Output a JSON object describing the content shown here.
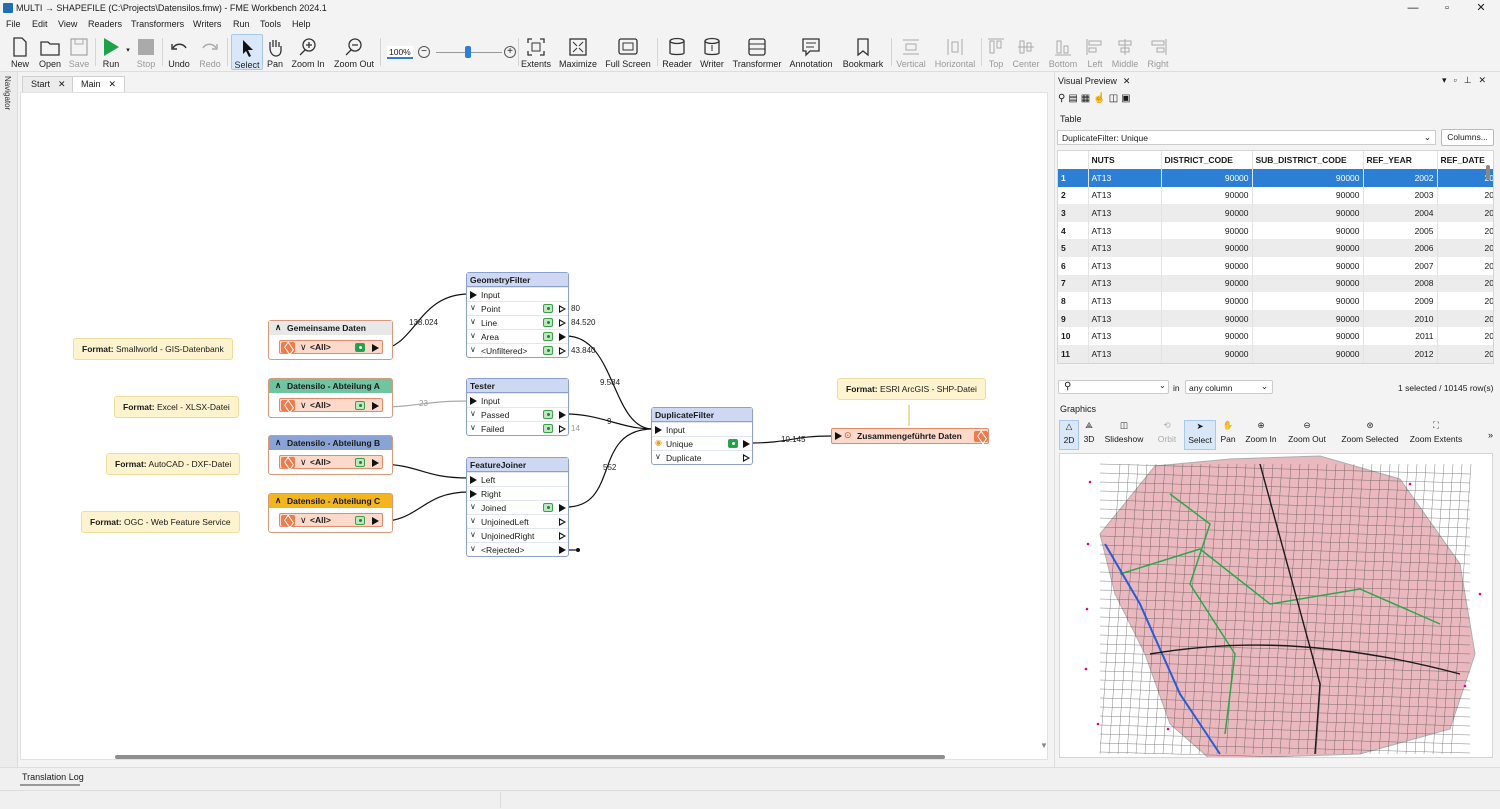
{
  "window": {
    "title": "MULTI → SHAPEFILE (C:\\Projects\\Datensilos.fmw) - FME Workbench 2024.1",
    "minimize": "—",
    "maximize": "▫",
    "close": "✕"
  },
  "menu": [
    "File",
    "Edit",
    "View",
    "Readers",
    "Transformers",
    "Writers",
    "Run",
    "Tools",
    "Help"
  ],
  "toolbar": {
    "new": "New",
    "open": "Open",
    "save": "Save",
    "run": "Run",
    "stop": "Stop",
    "undo": "Undo",
    "redo": "Redo",
    "select": "Select",
    "pan": "Pan",
    "zoom_in": "Zoom In",
    "zoom_out": "Zoom Out",
    "zoom_level": "100%",
    "extents": "Extents",
    "maximize": "Maximize",
    "full_screen": "Full Screen",
    "reader": "Reader",
    "writer": "Writer",
    "transformer": "Transformer",
    "annotation": "Annotation",
    "bookmark": "Bookmark",
    "vertical": "Vertical",
    "horizontal": "Horizontal",
    "top": "Top",
    "center": "Center",
    "bottom": "Bottom",
    "left": "Left",
    "middle": "Middle",
    "right": "Right"
  },
  "navigator_label": "Navigator",
  "tabs": [
    {
      "label": "Start",
      "close": "✕"
    },
    {
      "label": "Main",
      "close": "✕"
    }
  ],
  "annotations": {
    "a1": {
      "key": "Format:",
      "value": "Smallworld - GIS-Datenbank"
    },
    "a2": {
      "key": "Format:",
      "value": "Excel - XLSX-Datei"
    },
    "a3": {
      "key": "Format:",
      "value": "AutoCAD - DXF-Datei"
    },
    "a4": {
      "key": "Format:",
      "value": "OGC - Web Feature Service"
    },
    "a5": {
      "key": "Format:",
      "value": "ESRI ArcGIS - SHP-Datei"
    }
  },
  "readers": [
    {
      "title": "Gemeinsame Daten",
      "port": "<All>",
      "color": "#e8e8e8"
    },
    {
      "title": "Datensilo - Abteilung A",
      "port": "<All>",
      "color": "#6fc4a2"
    },
    {
      "title": "Datensilo - Abteilung B",
      "port": "<All>",
      "color": "#8aa3d6"
    },
    {
      "title": "Datensilo - Abteilung C",
      "port": "<All>",
      "color": "#f2b41f"
    }
  ],
  "geometryfilter": {
    "title": "GeometryFilter",
    "input": "Input",
    "ports": [
      "Point",
      "Line",
      "Area",
      "<Unfiltered>"
    ],
    "counts": [
      "80",
      "84.520",
      "",
      "43.840"
    ]
  },
  "tester": {
    "title": "Tester",
    "input": "Input",
    "ports": [
      "Passed",
      "Failed"
    ],
    "counts": [
      "",
      "14"
    ]
  },
  "featurejoiner": {
    "title": "FeatureJoiner",
    "inputs": [
      "Left",
      "Right"
    ],
    "ports": [
      "Joined",
      "UnjoinedLeft",
      "UnjoinedRight",
      "<Rejected>"
    ]
  },
  "duplicatefilter": {
    "title": "DuplicateFilter",
    "input": "Input",
    "ports": [
      "Unique",
      "Duplicate"
    ]
  },
  "writer": {
    "title": "Zusammengeführte Daten"
  },
  "links": {
    "l1": "138.024",
    "l2": "23",
    "l3": "9.584",
    "l4": "9",
    "l5": "552",
    "l6": "10.145"
  },
  "preview": {
    "panel_title": "Visual Preview",
    "close": "✕",
    "table_label": "Table",
    "source_select": "DuplicateFilter: Unique",
    "columns_button": "Columns...",
    "headers": [
      "",
      "NUTS",
      "DISTRICT_CODE",
      "SUB_DISTRICT_CODE",
      "REF_YEAR",
      "REF_DATE"
    ],
    "rows": [
      [
        "1",
        "AT13",
        "90000",
        "90000",
        "2002",
        "20"
      ],
      [
        "2",
        "AT13",
        "90000",
        "90000",
        "2003",
        "20"
      ],
      [
        "3",
        "AT13",
        "90000",
        "90000",
        "2004",
        "20"
      ],
      [
        "4",
        "AT13",
        "90000",
        "90000",
        "2005",
        "20"
      ],
      [
        "5",
        "AT13",
        "90000",
        "90000",
        "2006",
        "20"
      ],
      [
        "6",
        "AT13",
        "90000",
        "90000",
        "2007",
        "20"
      ],
      [
        "7",
        "AT13",
        "90000",
        "90000",
        "2008",
        "20"
      ],
      [
        "8",
        "AT13",
        "90000",
        "90000",
        "2009",
        "20"
      ],
      [
        "9",
        "AT13",
        "90000",
        "90000",
        "2010",
        "20"
      ],
      [
        "10",
        "AT13",
        "90000",
        "90000",
        "2011",
        "20"
      ],
      [
        "11",
        "AT13",
        "90000",
        "90000",
        "2012",
        "20"
      ]
    ],
    "search_placeholder": "",
    "in_label": "in",
    "column_select": "any column",
    "status": "1 selected / 10145 row(s)",
    "graphics_label": "Graphics",
    "gbuttons": [
      "2D",
      "3D",
      "Slideshow",
      "Orbit",
      "Select",
      "Pan",
      "Zoom In",
      "Zoom Out",
      "Zoom Selected",
      "Zoom Extents"
    ],
    "more": "»"
  },
  "translation_log": "Translation Log",
  "colors": {
    "accent": "#2d7fd6",
    "reader_border": "#d99a7b",
    "transformer_header": "#cfd8f3"
  }
}
